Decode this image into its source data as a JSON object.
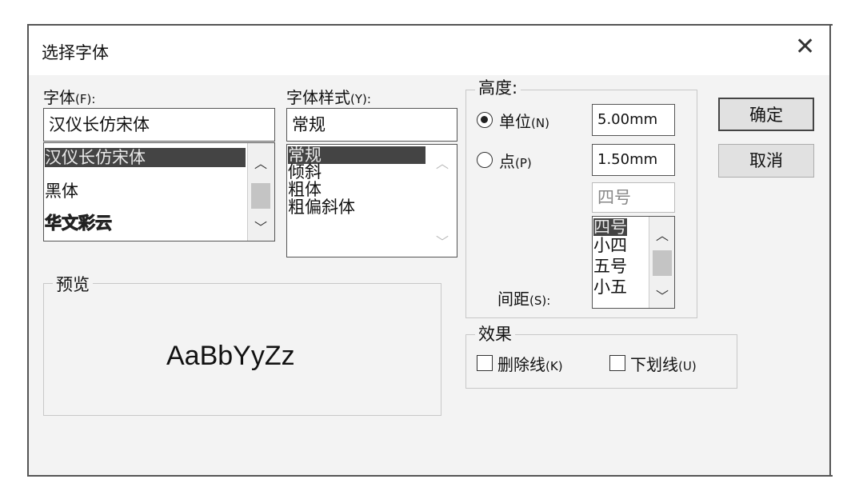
{
  "dialog": {
    "title": "选择字体",
    "close_glyph": "✕"
  },
  "font": {
    "label": "字体",
    "shortcut": "(F):",
    "value": "汉仪长仿宋体",
    "options": [
      "汉仪长仿宋体",
      "黑体",
      "华文彩云"
    ],
    "selected_index": 0
  },
  "style": {
    "label": "字体样式",
    "shortcut": "(Y):",
    "value": "常规",
    "options": [
      "常规",
      "倾斜",
      "粗体",
      "粗偏斜体"
    ],
    "selected_index": 0
  },
  "height": {
    "group_label": "高度:",
    "unit_label": "单位",
    "unit_shortcut": "(N)",
    "unit_value": "5.00mm",
    "unit_checked": true,
    "point_label": "点",
    "point_shortcut": "(P)",
    "point_value": "1.50mm",
    "point_checked": false,
    "size_value": "四号",
    "size_options": [
      "四号",
      "小四",
      "五号",
      "小五"
    ],
    "spacing_label": "间距",
    "spacing_shortcut": "(S):"
  },
  "preview": {
    "group_label": "预览",
    "sample": "AaBbYyZz"
  },
  "effects": {
    "group_label": "效果",
    "strike_label": "删除线",
    "strike_shortcut": "(K)",
    "strike_checked": false,
    "underline_label": "下划线",
    "underline_shortcut": "(U)",
    "underline_checked": false
  },
  "buttons": {
    "ok": "确定",
    "cancel": "取消"
  },
  "icons": {
    "up": "chevron-up-icon",
    "down": "chevron-down-icon",
    "close": "close-icon"
  }
}
